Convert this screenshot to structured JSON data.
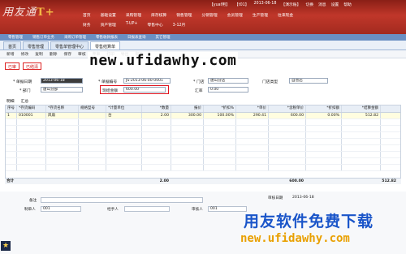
{
  "header": {
    "logo_text": "用友通",
    "logo_mark": "T+",
    "info": [
      "【yuaf用】",
      "【t01】",
      "2013-06-18",
      "【演示账】",
      "切换",
      "消息",
      "设置",
      "帮助"
    ],
    "menu_row1": [
      "首页",
      "基础设置",
      "采购管理",
      "库存核算",
      "销售管理",
      "分销管理",
      "会员管理",
      "生产管理",
      "往来现金"
    ],
    "menu_row2": [
      "财务",
      "资产管理",
      "T-UP+",
      "零售中心",
      "3-12月"
    ]
  },
  "subnav": [
    "零售管理",
    "销售订单业务",
    "采购订单管理",
    "零售收款报表",
    "日报表查询",
    "其它管理"
  ],
  "tabs": [
    {
      "label": "首页",
      "active": false
    },
    {
      "label": "零售管理",
      "active": false
    },
    {
      "label": "零售单管理中心",
      "active": false
    },
    {
      "label": "零售结算单",
      "active": true
    }
  ],
  "toolbar": [
    "新增",
    "修改",
    "复制",
    "删除",
    "保存",
    "审核",
    "弃审",
    "打印",
    "导出",
    "帮助"
  ],
  "watermark": "new.ufidawhy.com",
  "status_buttons": [
    "已审",
    "已结清"
  ],
  "form": {
    "date_label": "* 单据日期",
    "date_value": "2013-06-18",
    "code_label": "* 单据编号",
    "code_value": "JS-2013-06-00-0001",
    "store_label": "* 门店",
    "store_value": "唐山分店",
    "store_type_label": "门店类型",
    "store_type_value": "自营店",
    "dept_label": "* 部门",
    "dept_value": "唐山分部",
    "cash_label": "现结金额",
    "cash_value": "600.00",
    "rate_label": "汇率",
    "rate_value": "0.00"
  },
  "subtabs": [
    "明细",
    "汇总"
  ],
  "grid": {
    "columns": [
      "序号",
      "*存货编码",
      "*存货名称",
      "规格型号",
      "*计量单位",
      "*数量",
      "报价",
      "*折扣%",
      "*单价",
      "*含税单价",
      "*折扣额",
      "*结算金额"
    ],
    "rows": [
      [
        "1",
        "010001",
        "风扇",
        "",
        "台",
        "2.00",
        "300.00",
        "100.00%",
        "290.41",
        "600.00",
        "0.00%",
        "512.82"
      ]
    ],
    "total_label": "合计",
    "total_qty": "2.00",
    "total_amount": "600.00",
    "total_settle": "512.82"
  },
  "footer": {
    "memo_label": "备注",
    "maker_label": "制单人",
    "maker_value": "001",
    "manager_label": "经手人",
    "auditor_label": "审核人",
    "auditor_value": "001",
    "audit_date_label": "审核日期",
    "audit_date_value": "2013-06-18"
  },
  "ad": {
    "line1": "用友软件免费下载",
    "line2": "new.ufidawhy.com"
  },
  "colors": {
    "header": "#b83226",
    "highlight": "#e0141e",
    "ad_blue": "#1a55c9",
    "ad_orange": "#e9a000"
  }
}
